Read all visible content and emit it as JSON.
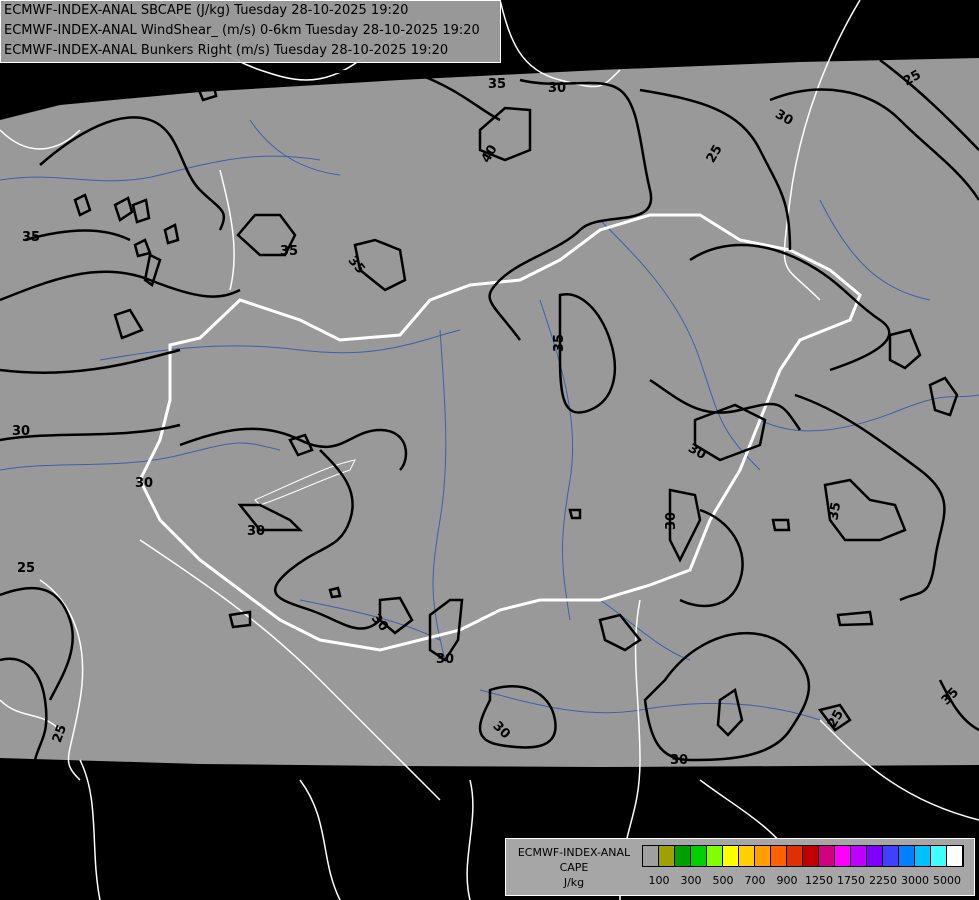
{
  "header": {
    "line1": "ECMWF-INDEX-ANAL SBCAPE (J/kg) Tuesday 28-10-2025 19:20",
    "line2": "ECMWF-INDEX-ANAL WindShear_ (m/s) 0-6km Tuesday 28-10-2025 19:20",
    "line3": "ECMWF-INDEX-ANAL Bunkers Right (m/s) Tuesday 28-10-2025 19:20"
  },
  "map": {
    "background_color": "#999999",
    "nodata_color": "#000000",
    "border_color": "#ffffff",
    "river_color": "#3f5fa8",
    "contour_color": "#000000",
    "contour_labels": [
      "35",
      "30",
      "40",
      "25",
      "30",
      "35",
      "35",
      "35",
      "35",
      "30",
      "30",
      "30",
      "25",
      "30",
      "30",
      "30",
      "30",
      "25",
      "35",
      "35",
      "30"
    ]
  },
  "legend": {
    "title": "ECMWF-INDEX-ANAL",
    "subtitle": "CAPE",
    "unit": "J/kg",
    "colors": [
      "#a0a0a0",
      "#a0a000",
      "#00a000",
      "#00d000",
      "#80ff00",
      "#ffff00",
      "#ffd000",
      "#ffa000",
      "#ff6000",
      "#e03000",
      "#c00000",
      "#d00080",
      "#ff00ff",
      "#c000ff",
      "#8000ff",
      "#4040ff",
      "#0080ff",
      "#00c0ff",
      "#40ffff",
      "#ffffff"
    ],
    "labels": [
      "100",
      "300",
      "500",
      "700",
      "900",
      "1250",
      "1750",
      "2250",
      "3000",
      "5000"
    ]
  }
}
